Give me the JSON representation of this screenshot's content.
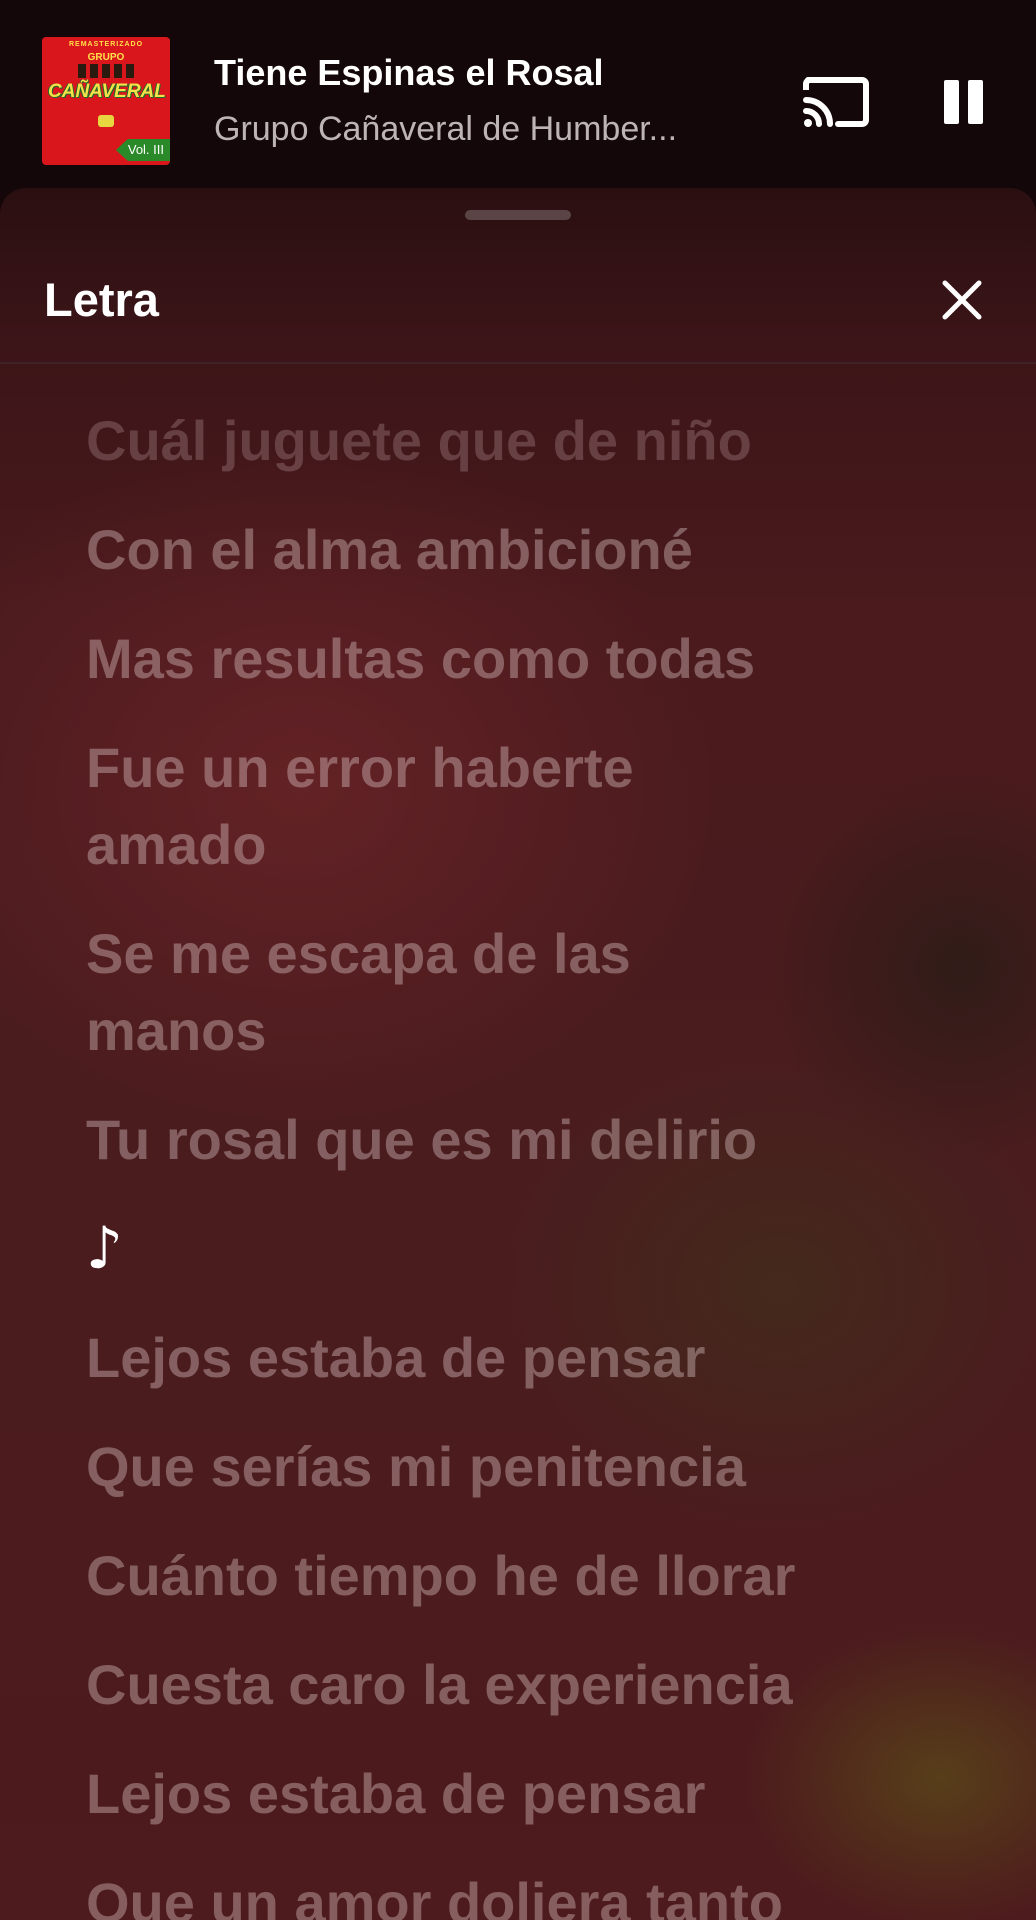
{
  "mini_player": {
    "track_title": "Tiene Espinas el Rosal",
    "artist": "Grupo Cañaveral de Humber...",
    "album_art": {
      "top_text": "REMASTERIZADO",
      "group_text": "GRUPO",
      "name_text": "CAÑAVERAL",
      "volume_text": "Vol. III"
    }
  },
  "sheet": {
    "title": "Letra"
  },
  "lyrics": [
    "Cuál juguete que de niño",
    "Con el alma ambicioné",
    "Mas resultas como todas",
    "Fue un error haberte amado",
    "Se me escapa de las manos",
    "Tu rosal que es mi delirio",
    "♪",
    "Lejos estaba de pensar",
    "Que serías mi penitencia",
    "Cuánto tiempo he de llorar",
    "Cuesta caro la experiencia",
    "Lejos estaba de pensar",
    "Que un amor doliera tanto"
  ],
  "icons": {
    "cast": "cast-icon",
    "pause": "pause-icon",
    "close": "close-icon"
  },
  "colors": {
    "background": "#150709",
    "sheet_tint": "#4a1a1d",
    "lyric_text": "rgba(235,215,215,0.36)"
  }
}
